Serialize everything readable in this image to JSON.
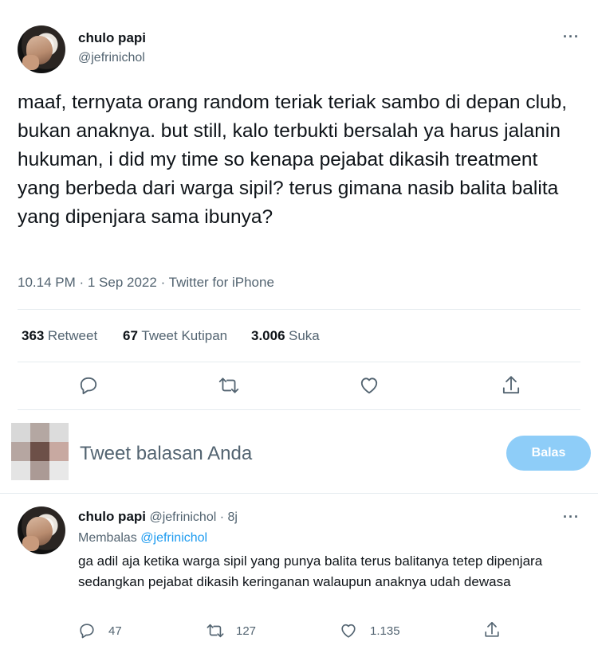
{
  "tweet": {
    "author_name": "chulo papi",
    "author_handle": "@jefrinichol",
    "text": "maaf, ternyata orang random teriak teriak sambo di depan club, bukan anaknya. but still, kalo terbukti bersalah ya harus jalanin hukuman, i did my time so kenapa pejabat dikasih treatment yang berbeda dari warga sipil? terus gimana nasib balita balita yang dipenjara sama ibunya?",
    "timestamp": "10.14 PM · 1 Sep 2022 · Twitter for iPhone",
    "stats": {
      "retweets": "363",
      "retweets_label": "Retweet",
      "quotes": "67",
      "quotes_label": "Tweet Kutipan",
      "likes": "3.006",
      "likes_label": "Suka"
    }
  },
  "composer": {
    "placeholder": "Tweet balasan Anda",
    "button_label": "Balas"
  },
  "reply": {
    "author_name": "chulo papi",
    "author_handle": "@jefrinichol",
    "time": "· 8j",
    "replying_prefix": "Membalas",
    "replying_to": "@jefrinichol",
    "text": "ga adil aja ketika warga sipil yang punya balita terus balitanya tetep dipenjara sedangkan pejabat dikasih keringanan walaupun anaknya udah dewasa",
    "reply_count": "47",
    "retweet_count": "127",
    "like_count": "1.135"
  },
  "icons": {
    "more": "more-dots-icon",
    "reply": "reply-icon",
    "retweet": "retweet-icon",
    "like": "heart-icon",
    "share": "share-icon"
  },
  "colors": {
    "accent": "#1d9bf0",
    "button_disabled": "#8ecdf8",
    "secondary_text": "#536471",
    "divider": "#e6ecf0"
  }
}
